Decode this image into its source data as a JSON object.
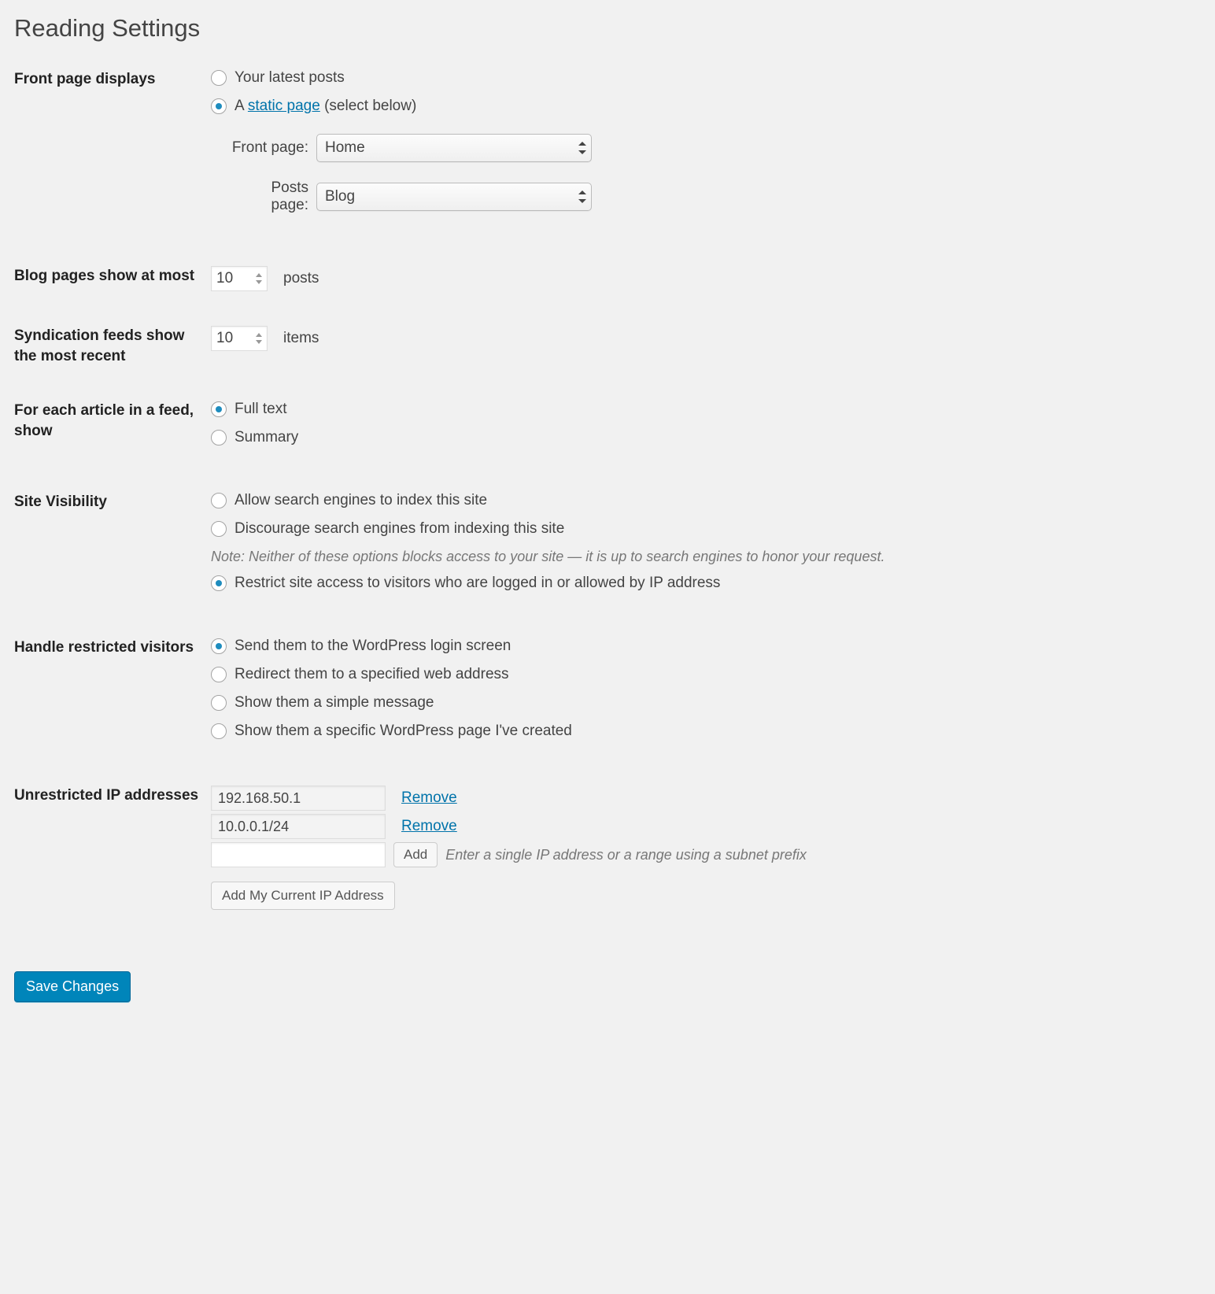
{
  "title": "Reading Settings",
  "front_page": {
    "label": "Front page displays",
    "option_latest": "Your latest posts",
    "option_static_prefix": "A ",
    "option_static_link": "static page",
    "option_static_suffix": " (select below)",
    "front_label": "Front page:",
    "front_value": "Home",
    "posts_label": "Posts page:",
    "posts_value": "Blog"
  },
  "blog_pages": {
    "label": "Blog pages show at most",
    "value": "10",
    "unit": "posts"
  },
  "syndication": {
    "label": "Syndication feeds show the most recent",
    "value": "10",
    "unit": "items"
  },
  "article_feed": {
    "label": "For each article in a feed, show",
    "full": "Full text",
    "summary": "Summary"
  },
  "visibility": {
    "label": "Site Visibility",
    "allow": "Allow search engines to index this site",
    "discourage": "Discourage search engines from indexing this site",
    "note": "Note: Neither of these options blocks access to your site — it is up to search engines to honor your request.",
    "restrict": "Restrict site access to visitors who are logged in or allowed by IP address"
  },
  "restricted": {
    "label": "Handle restricted visitors",
    "login": "Send them to the WordPress login screen",
    "redirect": "Redirect them to a specified web address",
    "message": "Show them a simple message",
    "page": "Show them a specific WordPress page I've created"
  },
  "ips": {
    "label": "Unrestricted IP addresses",
    "list": [
      "192.168.50.1",
      "10.0.0.1/24"
    ],
    "remove": "Remove",
    "add": "Add",
    "hint": "Enter a single IP address or a range using a subnet prefix",
    "add_current": "Add My Current IP Address"
  },
  "save": "Save Changes"
}
